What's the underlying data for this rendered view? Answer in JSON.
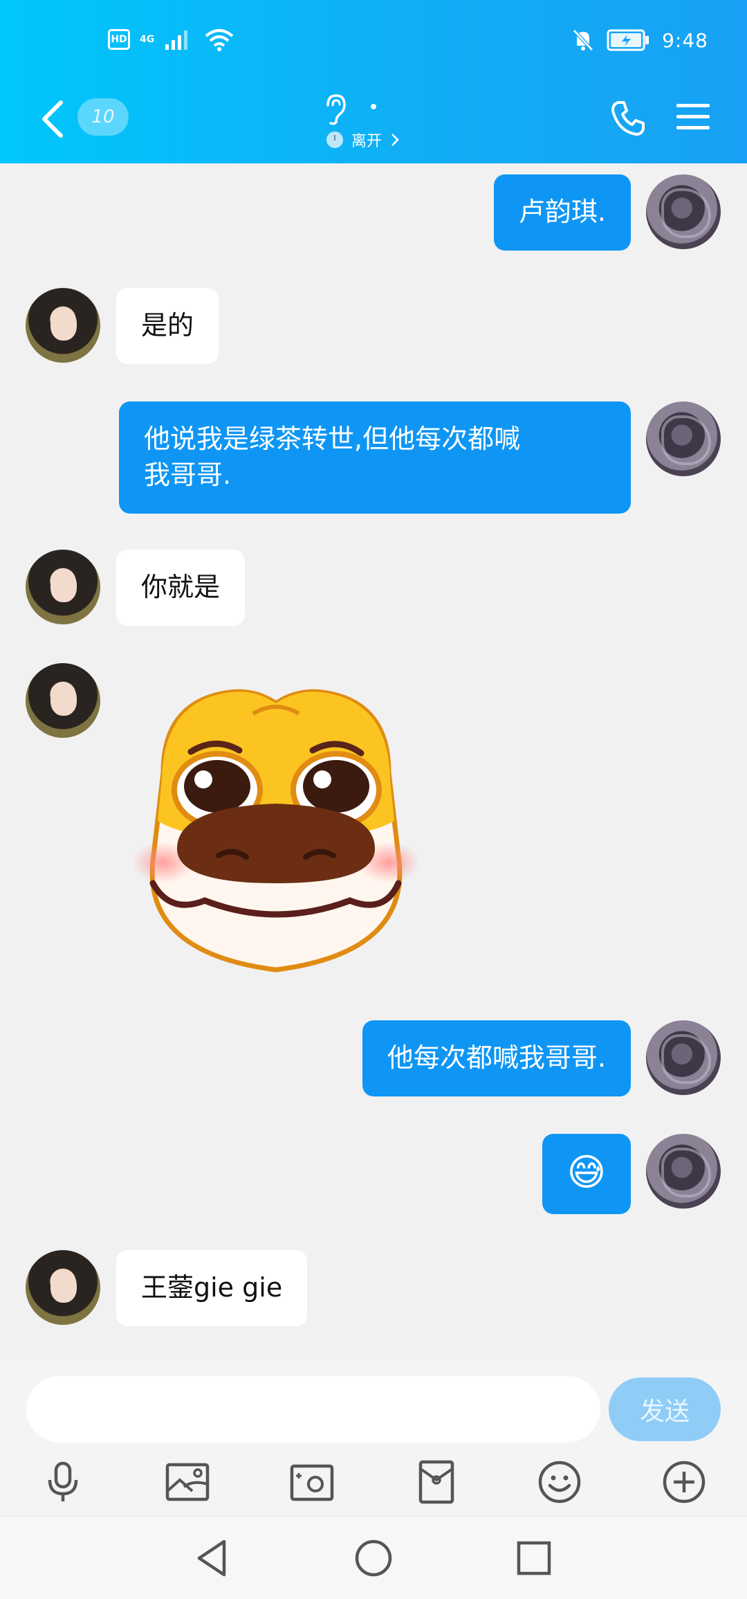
{
  "status_bar": {
    "hd": "HD",
    "network": "4G",
    "time": "9:48"
  },
  "header": {
    "unread_count": "10",
    "presence": "离开"
  },
  "messages": [
    {
      "side": "out",
      "text": "卢韵琪."
    },
    {
      "side": "in",
      "text": "是的"
    },
    {
      "side": "out",
      "lines": [
        "他说我是绿茶转世,但他每次都喊",
        "我哥哥."
      ]
    },
    {
      "side": "in",
      "text": "你就是"
    },
    {
      "side": "in",
      "sticker": "smiling-dog-sticker"
    },
    {
      "side": "out",
      "text": "他每次都喊我哥哥."
    },
    {
      "side": "out",
      "emoji": "😅"
    },
    {
      "side": "in",
      "text": "王蓥gie gie"
    }
  ],
  "composer": {
    "input_value": "",
    "send_label": "发送"
  },
  "toolbar_icons": [
    "microphone-icon",
    "image-icon",
    "camera-icon",
    "red-packet-icon",
    "emoji-icon",
    "plus-icon"
  ],
  "colors": {
    "header_start": "#00c7fb",
    "header_end": "#18a1f4",
    "bubble_out": "#0f96f5",
    "bubble_in": "#ffffff",
    "background": "#f1f1f1"
  }
}
